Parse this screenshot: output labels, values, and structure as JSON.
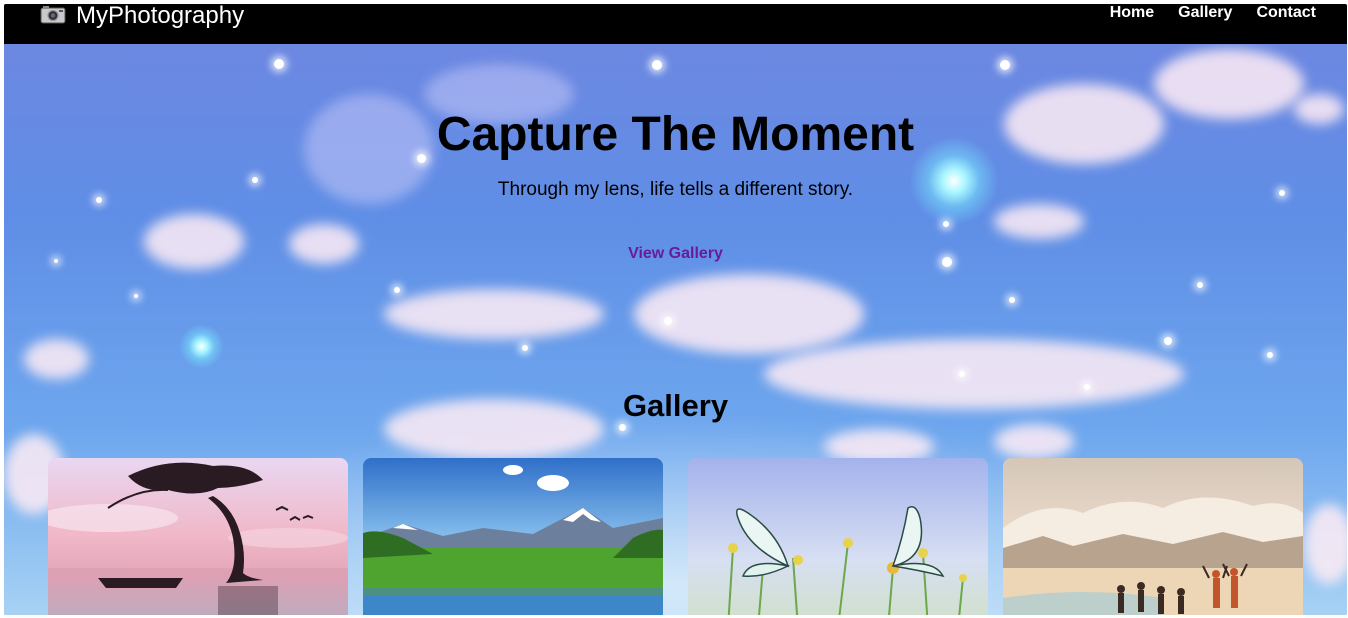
{
  "brand": {
    "icon": "camera-icon",
    "label": "MyPhotography"
  },
  "nav": {
    "links": [
      "Home",
      "Gallery",
      "Contact"
    ]
  },
  "hero": {
    "title": "Capture The Moment",
    "subtitle": "Through my lens, life tells a different story.",
    "cta_label": "View Gallery"
  },
  "gallery": {
    "heading": "Gallery",
    "images": [
      {
        "subject": "lone-tree-sunset-photo"
      },
      {
        "subject": "mountain-lake-photo"
      },
      {
        "subject": "butterflies-flowers-photo"
      },
      {
        "subject": "people-celebrating-mountain-photo"
      }
    ]
  },
  "colors": {
    "navbar_bg": "#000000",
    "cta_link": "#6a1b9a",
    "text": "#000000"
  }
}
